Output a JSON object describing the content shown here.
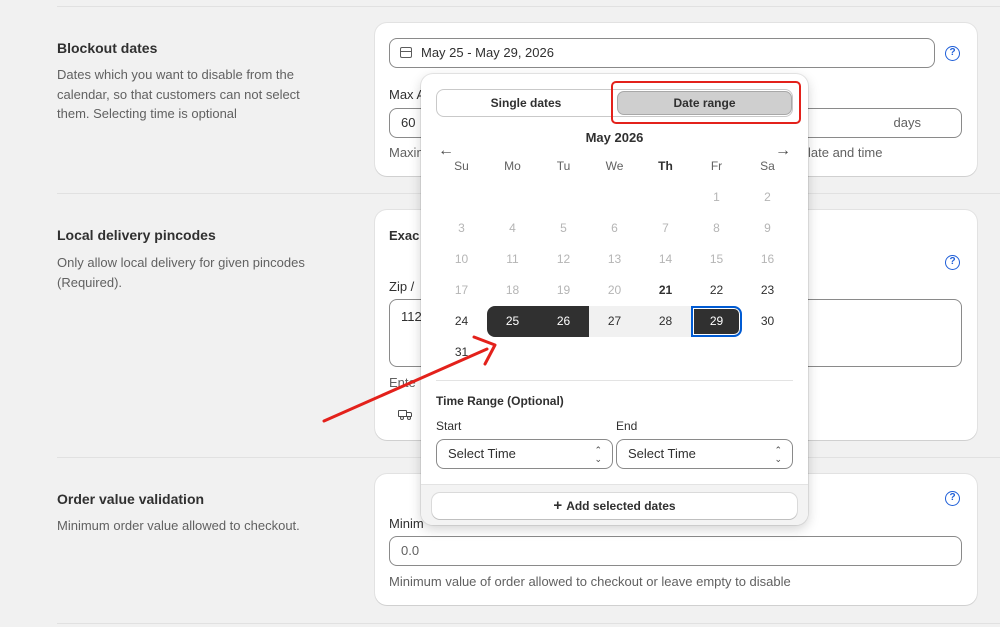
{
  "sections": {
    "blockout": {
      "title": "Blockout dates",
      "description": "Dates which you want to disable from the calendar, so that customers can not select them. Selecting time is optional",
      "field_value": "May 25 - May 29, 2026",
      "max_label_partial": "Max A",
      "max_value": "60",
      "days_suffix": "days",
      "help_partial_left": "Maxim",
      "help_partial_right": "late and time"
    },
    "pincodes": {
      "title": "Local delivery pincodes",
      "description": "Only allow local delivery for given pincodes (Required).",
      "exact_partial": "Exac",
      "zip_label_partial": "Zip / ",
      "zip_value_partial": "112",
      "enter_partial": "Ente"
    },
    "order_value": {
      "title": "Order value validation",
      "description": "Minimum order value allowed to checkout.",
      "min_label_partial": "Minim",
      "min_value": "0.0",
      "help": "Minimum value of order allowed to checkout or leave empty to disable"
    }
  },
  "picker": {
    "tabs": [
      "Single dates",
      "Date range"
    ],
    "active_tab": "Date range",
    "month": "May 2026",
    "weekdays": [
      "Su",
      "Mo",
      "Tu",
      "We",
      "Th",
      "Fr",
      "Sa"
    ],
    "weeks": [
      [
        "",
        "",
        "",
        "",
        "",
        "1",
        "2"
      ],
      [
        "3",
        "4",
        "5",
        "6",
        "7",
        "8",
        "9"
      ],
      [
        "10",
        "11",
        "12",
        "13",
        "14",
        "15",
        "16"
      ],
      [
        "17",
        "18",
        "19",
        "20",
        "21",
        "22",
        "23"
      ],
      [
        "24",
        "25",
        "26",
        "27",
        "28",
        "29",
        "30"
      ],
      [
        "31",
        "",
        "",
        "",
        "",
        "",
        ""
      ]
    ],
    "time_range_title": "Time Range (Optional)",
    "start_label": "Start",
    "end_label": "End",
    "start_placeholder": "Select Time",
    "end_placeholder": "Select Time",
    "add_button": "Add selected dates"
  },
  "icons": {
    "calendar": "calendar-icon",
    "help": "question-circle-icon",
    "truck": "truck-icon",
    "prev": "arrow-left-icon",
    "next": "arrow-right-icon",
    "plus": "plus-icon"
  },
  "colors": {
    "selected": "#303030",
    "focus": "#005bd3",
    "annotation": "#e3211b",
    "help_icon": "#1f5fd8"
  }
}
